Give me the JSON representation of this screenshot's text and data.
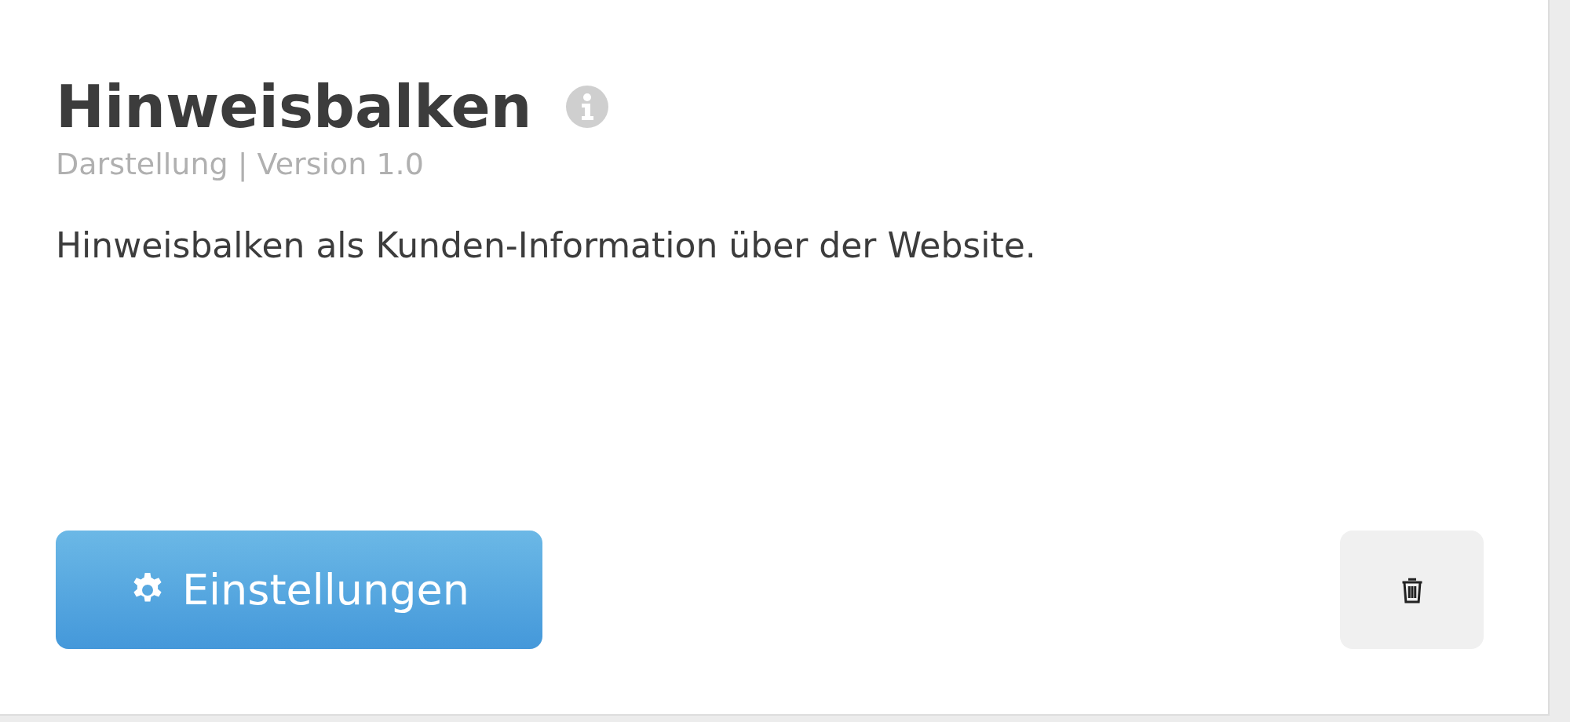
{
  "card": {
    "title": "Hinweisbalken",
    "meta": "Darstellung | Version 1.0",
    "description": "Hinweisbalken als Kunden-Information über der Website.",
    "settings_button": {
      "label": "Einstellungen"
    }
  }
}
